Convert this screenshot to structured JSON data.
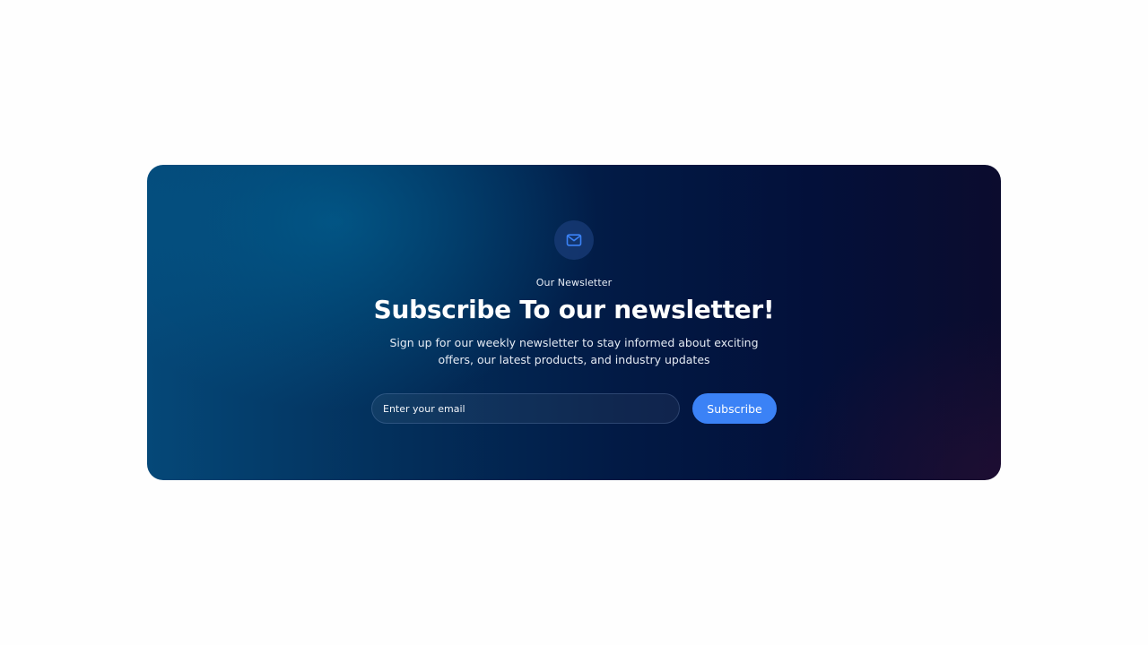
{
  "newsletter": {
    "eyebrow": "Our Newsletter",
    "title": "Subscribe To our newsletter!",
    "description": "Sign up for our weekly newsletter to stay informed about exciting offers, our latest products, and industry updates",
    "email_placeholder": "Enter your email",
    "email_value": "",
    "subscribe_label": "Subscribe",
    "icon": "mail-icon"
  },
  "colors": {
    "accent": "#3b82f6",
    "card_from": "#054878",
    "card_to": "#0b0c2e",
    "page_bg": "#fefefe"
  }
}
